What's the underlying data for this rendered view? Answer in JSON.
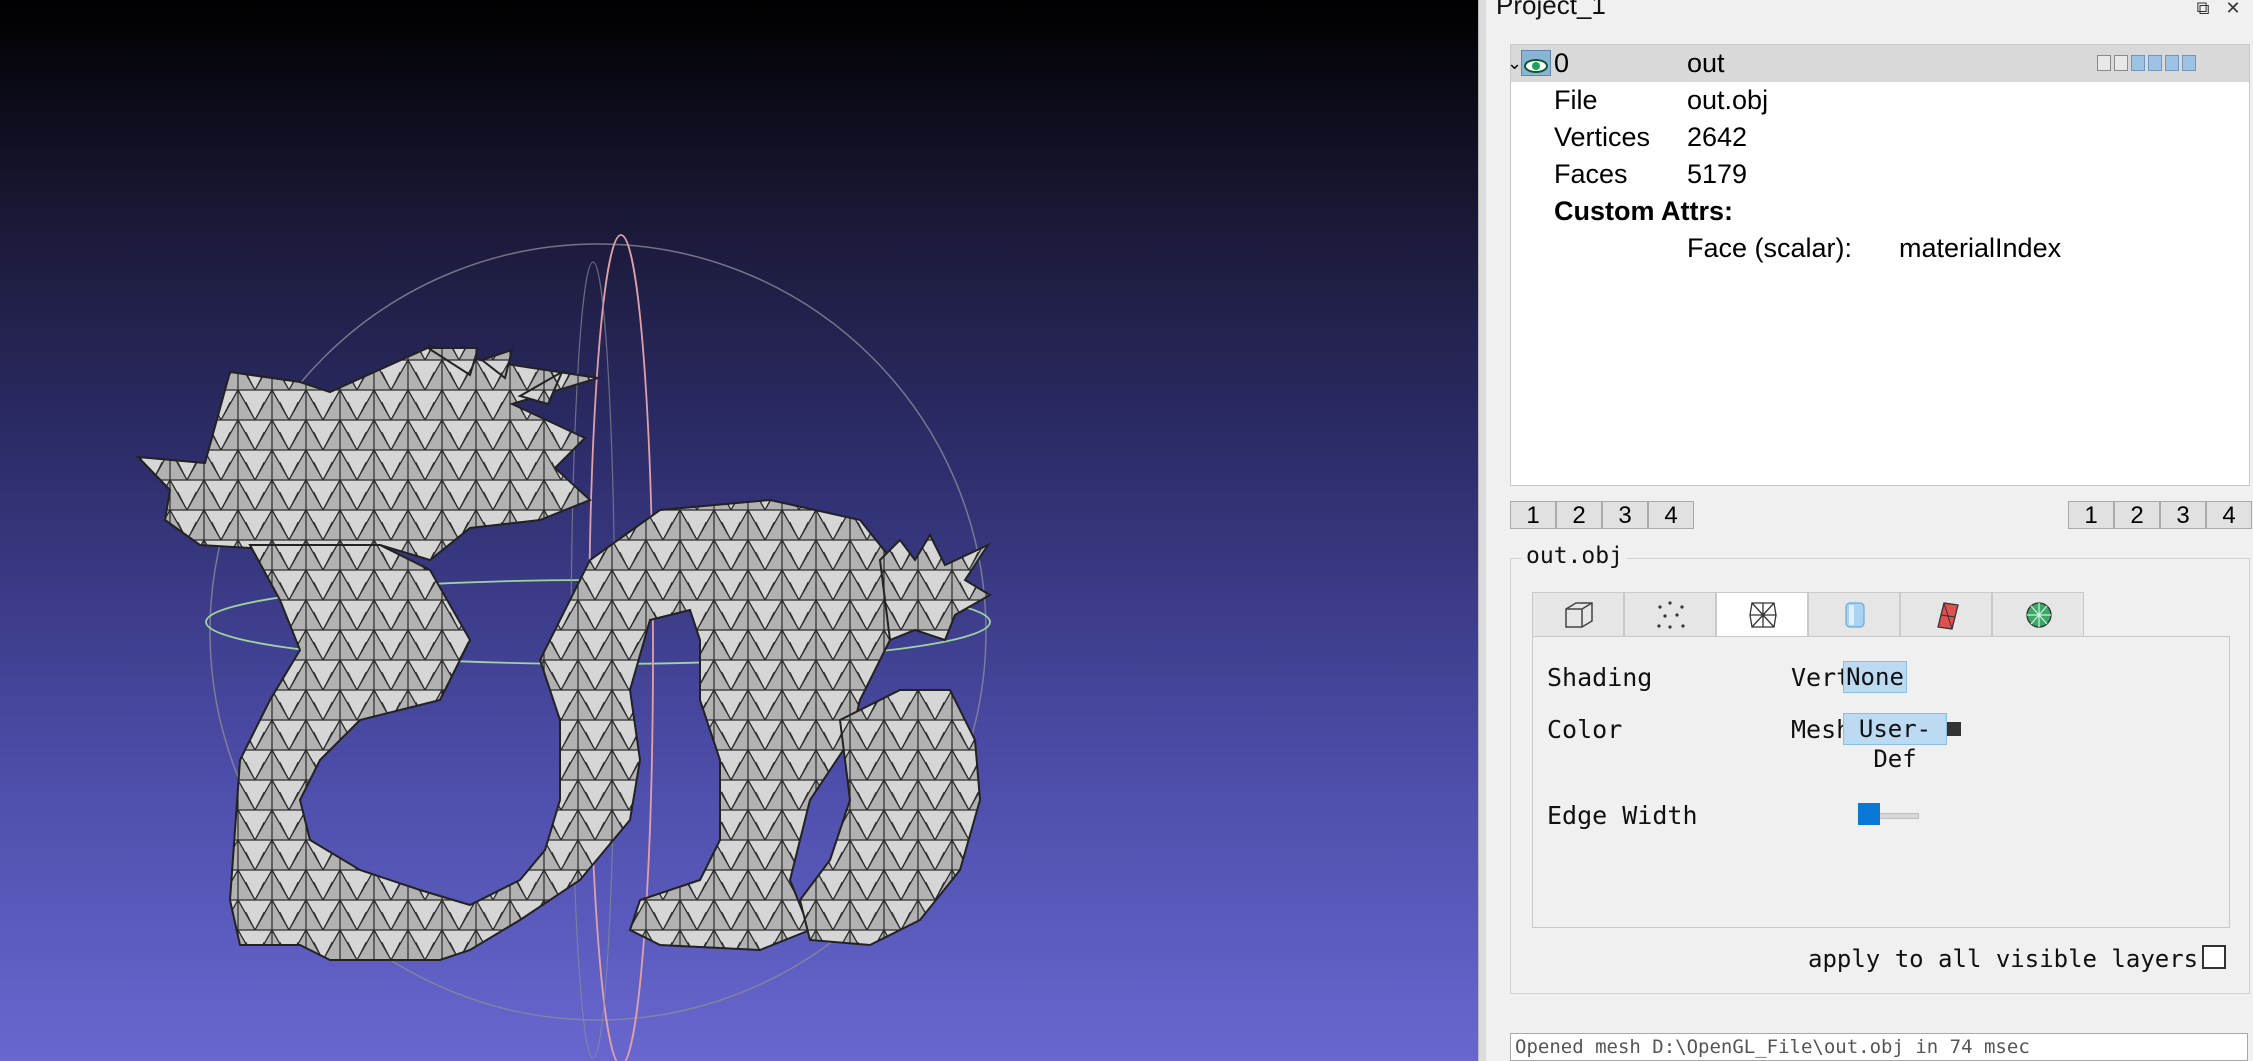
{
  "panel": {
    "title": "Project_1"
  },
  "tree": {
    "layer": {
      "id": "0",
      "name": "out"
    },
    "rows": [
      {
        "key": "File",
        "value": "out.obj"
      },
      {
        "key": "Vertices",
        "value": "2642"
      },
      {
        "key": "Faces",
        "value": "5179"
      }
    ],
    "custom_attrs_label": "Custom Attrs:",
    "custom_attr": {
      "type": "Face (scalar):",
      "name": "materialIndex"
    }
  },
  "left_buttons": [
    "1",
    "2",
    "3",
    "4"
  ],
  "right_buttons": [
    "1",
    "2",
    "3",
    "4"
  ],
  "decorator": {
    "title": "out.obj",
    "tabs": [
      "box-icon",
      "points-icon",
      "wireframe-icon",
      "cylinder-icon",
      "red-mesh-icon",
      "green-mesh-icon"
    ],
    "active_tab": 2,
    "shading_label": "Shading",
    "shading_sub": "Vert",
    "shading_value": "None",
    "color_label": "Color",
    "color_sub": "Mesh",
    "color_value": "User-Def",
    "color_swatch": "#333333",
    "edge_width_label": "Edge Width",
    "edge_width_slider": 0.05
  },
  "apply_label": "apply to all visible layers",
  "apply_checked": false,
  "status": "Opened mesh D:\\OpenGL_File\\out.obj in 74 msec",
  "colors": {
    "accent": "#0a78d7",
    "combo": "#bcdaf2",
    "selected_row": "#d9d9d9"
  }
}
